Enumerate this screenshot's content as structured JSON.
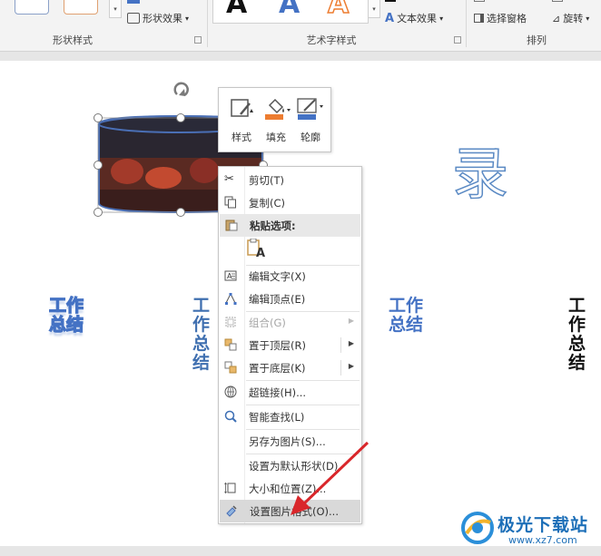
{
  "ribbon": {
    "shape_styles": {
      "shape_effects_label": "形状效果",
      "group_label": "形状样式"
    },
    "wordart_styles": {
      "sample_letter": "A",
      "text_effects_label": "文本效果",
      "group_label": "艺术字样式"
    },
    "arrange": {
      "selection_pane_label": "选择窗格",
      "rotate_label": "旋转",
      "group_label": "排列"
    }
  },
  "slide": {
    "big_char": "录",
    "titles": [
      {
        "l1": "工作",
        "l2": "总结"
      },
      {
        "l1": "工作",
        "l2": "总结"
      },
      {
        "l1": "工作",
        "l2": "总结"
      },
      {
        "l1": "工作",
        "l2": "总结"
      }
    ]
  },
  "mini_toolbar": {
    "style_label": "样式",
    "fill_label": "填充",
    "outline_label": "轮廓"
  },
  "context_menu": {
    "cut": "剪切(T)",
    "copy": "复制(C)",
    "paste_options": "粘贴选项:",
    "paste_sample": "A",
    "edit_text": "编辑文字(X)",
    "edit_points": "编辑顶点(E)",
    "group": "组合(G)",
    "bring_front": "置于顶层(R)",
    "send_back": "置于底层(K)",
    "hyperlink": "超链接(H)...",
    "smart_lookup": "智能查找(L)",
    "save_as_picture": "另存为图片(S)...",
    "set_default_shape": "设置为默认形状(D)",
    "size_position": "大小和位置(Z)...",
    "format_picture": "设置图片格式(O)..."
  },
  "watermark": {
    "brand": "极光下载站",
    "url": "www.xz7.com"
  },
  "colors": {
    "accent_blue": "#4472c4",
    "arrow_red": "#d9262a",
    "fill_orange": "#ed7d31"
  }
}
